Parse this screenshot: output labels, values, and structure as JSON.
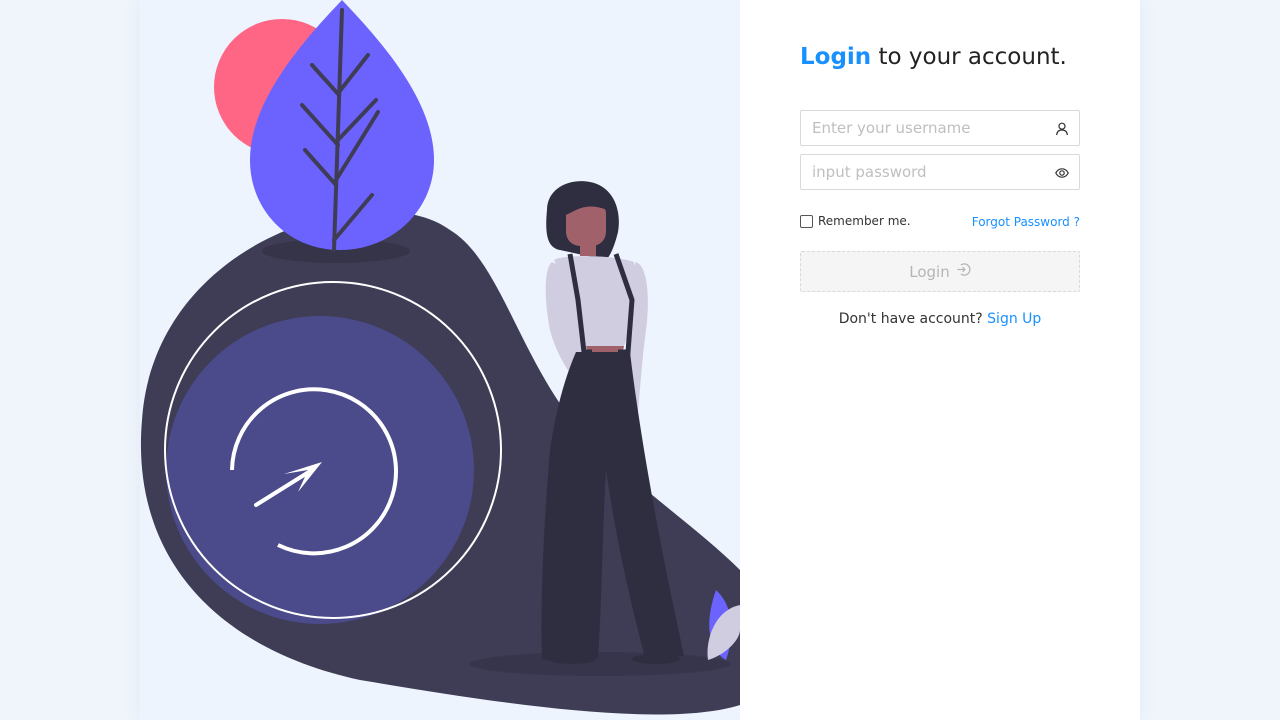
{
  "login_form": {
    "title_accent": "Login",
    "title_rest": " to your account.",
    "username_placeholder": "Enter your username",
    "password_placeholder": "input password",
    "remember_label": "Remember me.",
    "remember_checked": false,
    "forgot_label": "Forgot Password ?",
    "submit_label": "Login",
    "submit_icon": "login-icon",
    "username_icon": "user-icon",
    "password_icon": "eye-icon",
    "no_account_text": "Don't have account? ",
    "signup_label": "Sign Up"
  },
  "colors": {
    "accent": "#1890ff",
    "illustration_dark": "#3f3d56",
    "illustration_purple": "#6c63ff",
    "illustration_pink": "#ff6584"
  }
}
